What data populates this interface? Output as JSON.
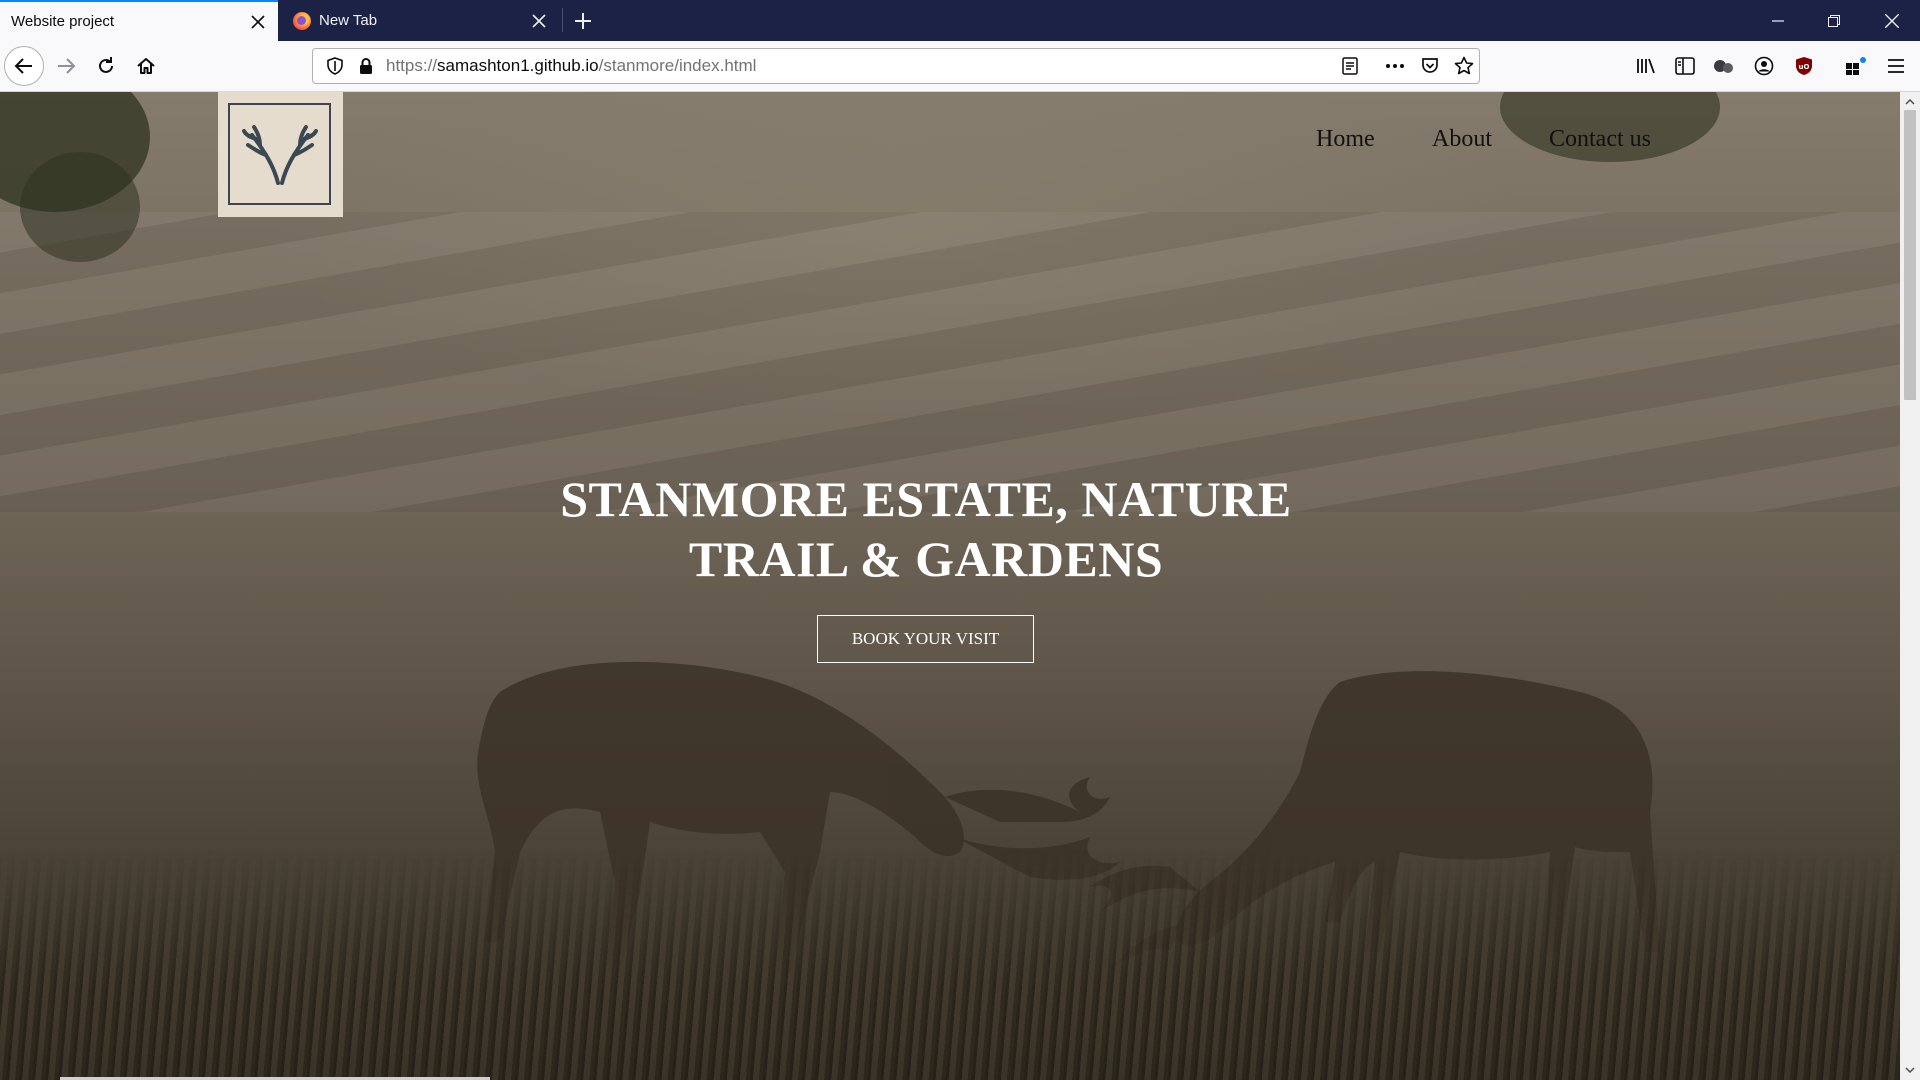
{
  "browser": {
    "tabs": [
      {
        "title": "Website project",
        "active": true
      },
      {
        "title": "New Tab",
        "active": false
      }
    ],
    "url": {
      "scheme": "https://",
      "host": "samashton1.github.io",
      "path": "/stanmore/index.html"
    },
    "accent_color": "#0a84ff",
    "tabbar_color": "#1c2146"
  },
  "site": {
    "nav": [
      "Home",
      "About",
      "Contact us"
    ],
    "headline_line1": "STANMORE ESTATE, NATURE",
    "headline_line2": "TRAIL & GARDENS",
    "cta_label": "BOOK YOUR VISIT",
    "logo_icon": "antlers-icon",
    "logo_bg_color": "#e6dccd"
  }
}
